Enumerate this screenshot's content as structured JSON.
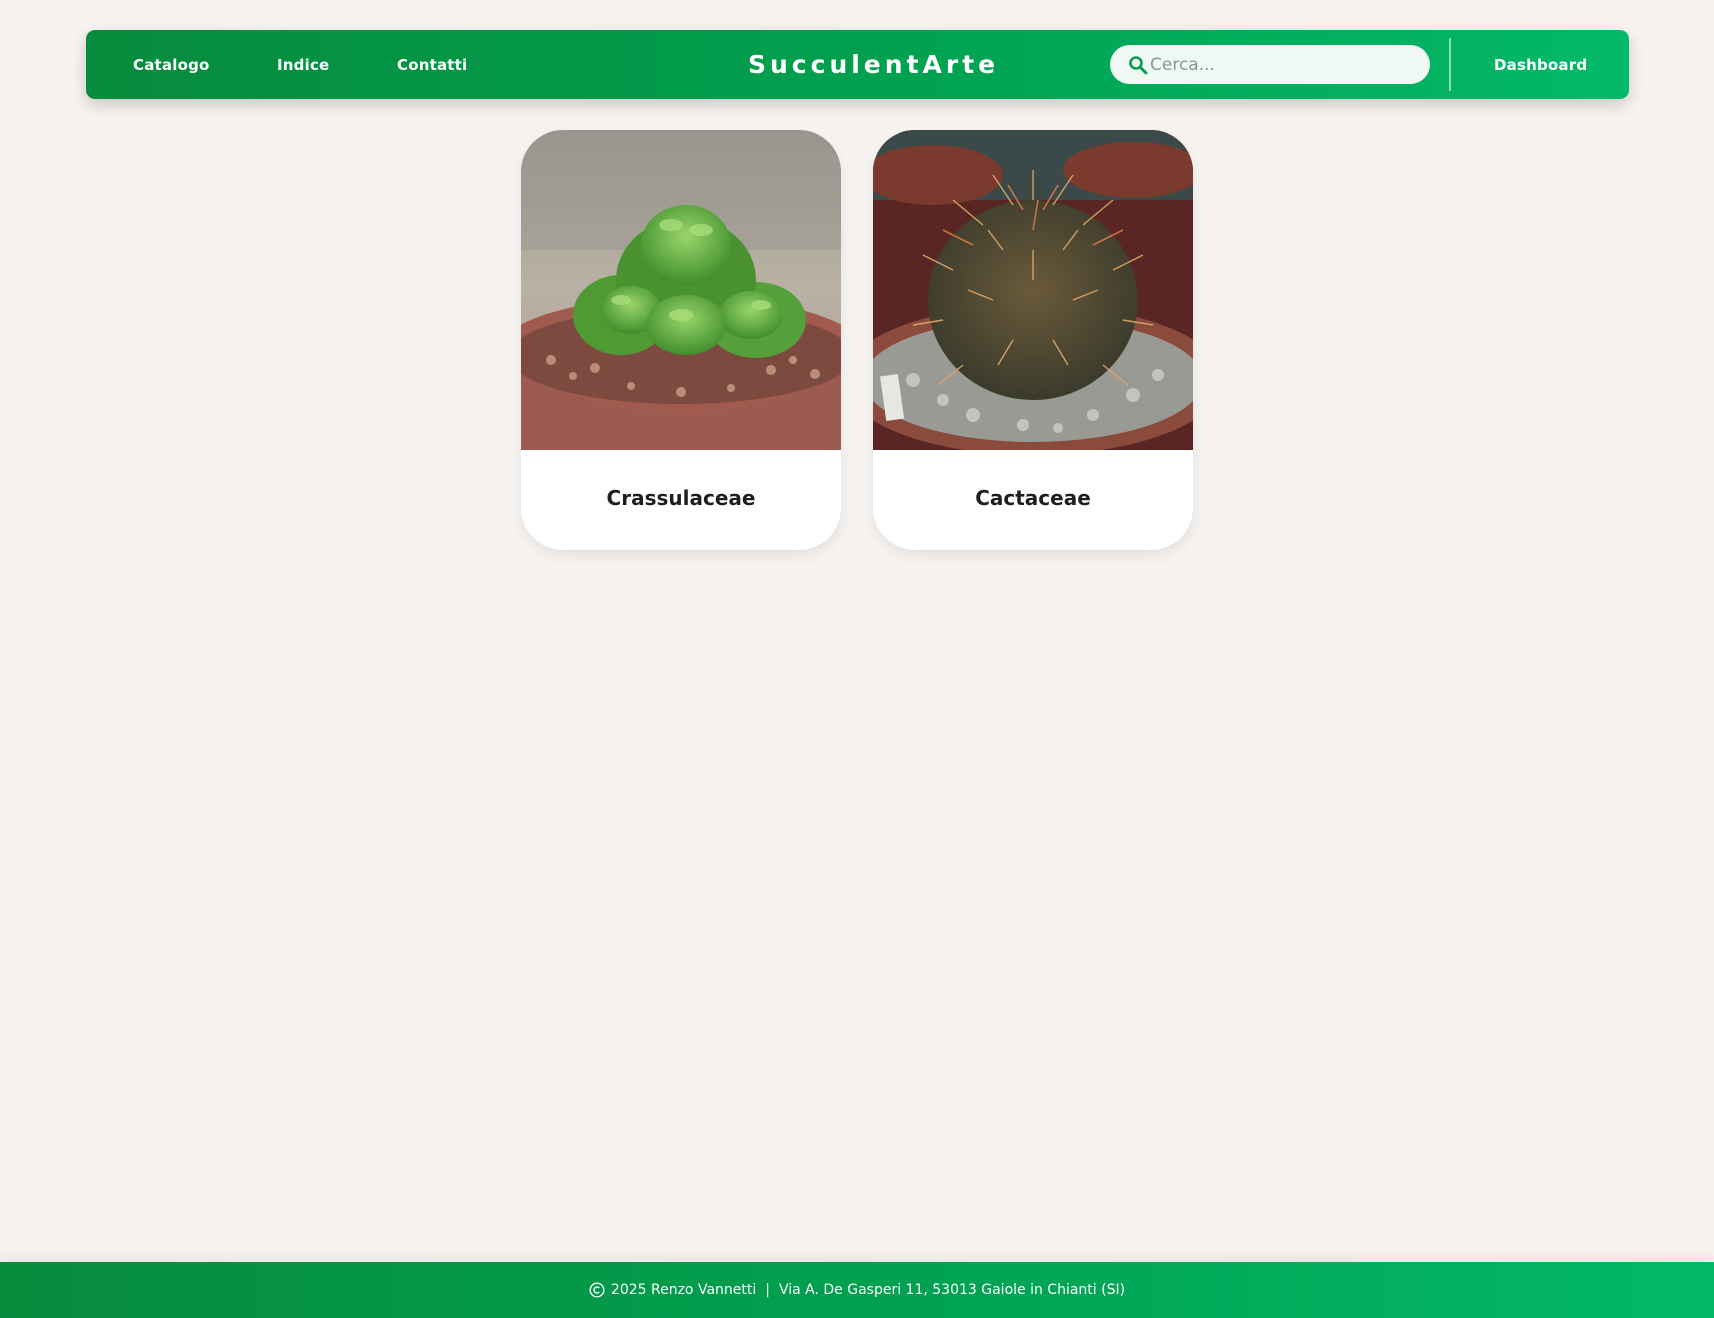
{
  "navbar": {
    "links": [
      "Catalogo",
      "Indice",
      "Contatti"
    ],
    "brand": "SucculentArte",
    "search": {
      "placeholder": "Cerca..."
    },
    "dashboard": "Dashboard"
  },
  "cards": [
    {
      "title": "Crassulaceae",
      "image": "succulent-rosette-photo"
    },
    {
      "title": "Cactaceae",
      "image": "barrel-cactus-photo"
    }
  ],
  "footer": {
    "copyright": "2025 Renzo Vannetti",
    "separator": "|",
    "address": "Via A. De Gasperi 11, 53013 Gaiole in Chianti (SI)"
  },
  "colors": {
    "primary_dark": "#078b3c",
    "primary": "#00a04f",
    "primary_light": "#03b968",
    "background": "#f6f3f0"
  }
}
